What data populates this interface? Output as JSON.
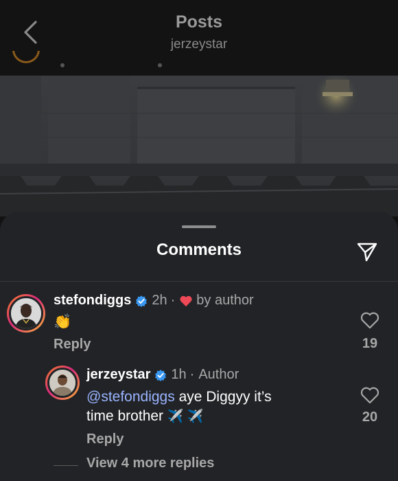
{
  "header": {
    "title": "Posts",
    "subtitle": "jerzeystar"
  },
  "sheet": {
    "title": "Comments"
  },
  "comments": [
    {
      "username": "stefondiggs",
      "time": "2h",
      "separator": "·",
      "liked_by_author_label": "by author",
      "text": "👏",
      "reply_label": "Reply",
      "like_count": "19"
    }
  ],
  "replies": [
    {
      "username": "jerzeystar",
      "time": "1h",
      "separator": "·",
      "role": "Author",
      "mention": "@stefondiggs",
      "text_line1": " aye Diggyy it’s",
      "text_line2": "time brother",
      "emoji": "✈️ ✈️",
      "reply_label": "Reply",
      "like_count": "20"
    }
  ],
  "view_more_replies": "View 4 more replies",
  "colors": {
    "sheet_bg": "#212326",
    "verified_blue": "#3897f0",
    "heart_red": "#ed4956",
    "mention_blue": "#9ab4ff",
    "muted_text": "#a8a8a8"
  },
  "icons": {
    "back": "chevron-left-icon",
    "share": "paper-plane-icon",
    "verified": "verified-badge-icon",
    "heart": "heart-icon"
  }
}
